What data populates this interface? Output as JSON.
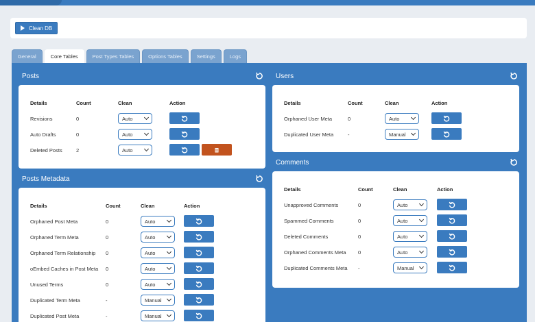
{
  "toolbar": {
    "clean_db_label": "Clean DB"
  },
  "tabs": [
    {
      "label": "General"
    },
    {
      "label": "Core Tables"
    },
    {
      "label": "Post Types Tables"
    },
    {
      "label": "Options Tables"
    },
    {
      "label": "Settings"
    },
    {
      "label": "Logs"
    }
  ],
  "active_tab": "Core Tables",
  "columns": {
    "details": "Details",
    "count": "Count",
    "clean": "Clean",
    "action": "Action"
  },
  "posts": {
    "title": "Posts",
    "rows": [
      {
        "details": "Revisions",
        "count": "0",
        "clean": "Auto"
      },
      {
        "details": "Auto Drafts",
        "count": "0",
        "clean": "Auto"
      },
      {
        "details": "Deleted Posts",
        "count": "2",
        "clean": "Auto"
      }
    ]
  },
  "posts_metadata": {
    "title": "Posts Metadata",
    "rows": [
      {
        "details": "Orphaned Post Meta",
        "count": "0",
        "clean": "Auto"
      },
      {
        "details": "Orphaned Term Meta",
        "count": "0",
        "clean": "Auto"
      },
      {
        "details": "Orphaned Term Relationship",
        "count": "0",
        "clean": "Auto"
      },
      {
        "details": "oEmbed Caches in Post Meta",
        "count": "0",
        "clean": "Auto"
      },
      {
        "details": "Unused Terms",
        "count": "0",
        "clean": "Auto"
      },
      {
        "details": "Duplicated Term Meta",
        "count": "-",
        "clean": "Manual"
      },
      {
        "details": "Duplicated Post Meta",
        "count": "-",
        "clean": "Manual"
      }
    ]
  },
  "users": {
    "title": "Users",
    "rows": [
      {
        "details": "Orphaned User Meta",
        "count": "0",
        "clean": "Auto"
      },
      {
        "details": "Duplicated User Meta",
        "count": "-",
        "clean": "Manual"
      }
    ]
  },
  "comments": {
    "title": "Comments",
    "rows": [
      {
        "details": "Unapproved Comments",
        "count": "0",
        "clean": "Auto"
      },
      {
        "details": "Spammed Comments",
        "count": "0",
        "clean": "Auto"
      },
      {
        "details": "Deleted Comments",
        "count": "0",
        "clean": "Auto"
      },
      {
        "details": "Orphaned Comments Meta",
        "count": "0",
        "clean": "Auto"
      },
      {
        "details": "Duplicated Comments Meta",
        "count": "-",
        "clean": "Manual"
      }
    ]
  },
  "colors": {
    "primary": "#3a7bbf",
    "danger": "#c2531e",
    "background": "#e9edf2"
  },
  "icons": {
    "section_refresh": "refresh-icon",
    "row_action": "undo-icon",
    "delete": "trash-icon",
    "run": "play-icon"
  }
}
